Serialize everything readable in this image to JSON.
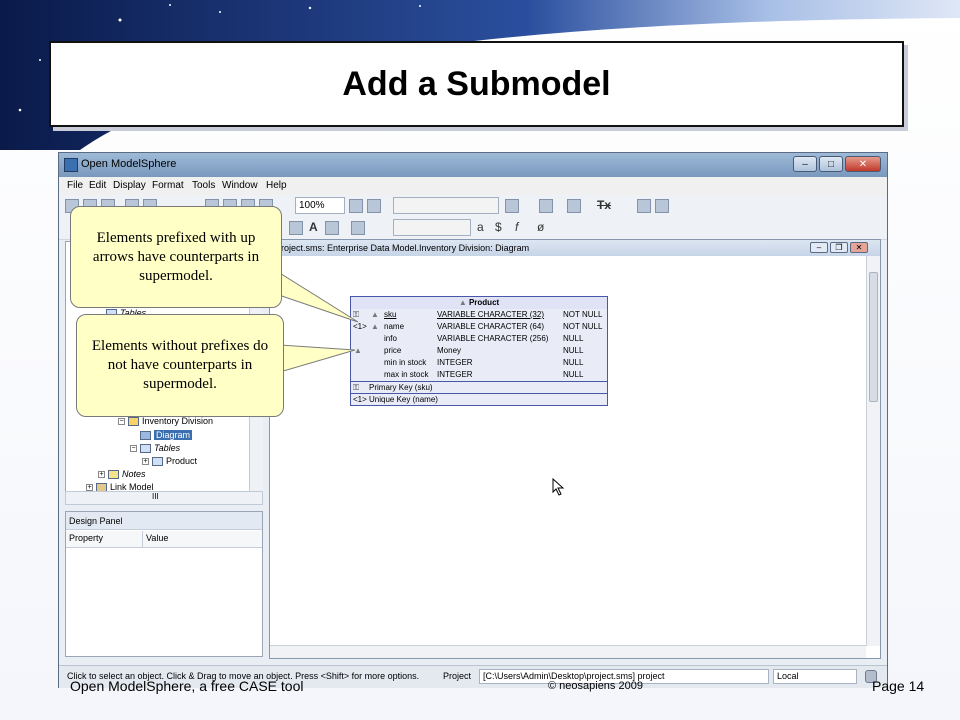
{
  "slide": {
    "title": "Add a Submodel",
    "footer_left": "Open ModelSphere, a free CASE tool",
    "footer_center": "© neosapiens 2009",
    "footer_right": "Page 14"
  },
  "window": {
    "title": "Open ModelSphere",
    "buttons": {
      "minimize": "–",
      "maximize": "□",
      "close": "✕"
    }
  },
  "menubar": {
    "items": [
      "File",
      "Edit",
      "Display",
      "Format",
      "Tools",
      "Window",
      "Help"
    ]
  },
  "toolbar": {
    "zoom_value": "100%",
    "font_glyph_a": "A",
    "text_glyph_a": "a",
    "text_glyph_dollar": "$",
    "text_glyph_f": "f",
    "text_glyph_null": "ø",
    "tx_glyph": "Tx"
  },
  "explorer": {
    "tree": [
      {
        "label": "Tables",
        "icon": "table-icon"
      },
      {
        "label": "Inventory Division",
        "icon": "model-icon"
      },
      {
        "label": "Diagram",
        "icon": "diagram-icon"
      },
      {
        "label": "Tables",
        "icon": "table-icon"
      },
      {
        "label": "Product",
        "icon": "table-icon"
      },
      {
        "label": "Notes",
        "icon": "folder-icon"
      },
      {
        "label": "Link Model",
        "icon": "link-model-icon"
      }
    ],
    "scroll_grip": "III"
  },
  "design_panel": {
    "title": "Design Panel",
    "columns": [
      "Property",
      "Value"
    ]
  },
  "diagram": {
    "title": "project.sms: Enterprise Data Model.Inventory Division: Diagram"
  },
  "product_table": {
    "name": "Product",
    "columns": [
      {
        "prefix": "",
        "name": "sku",
        "type": "VARIABLE CHARACTER (32)",
        "null": "NOT NULL",
        "underline": true
      },
      {
        "prefix": "<1>",
        "name": "name",
        "type": "VARIABLE CHARACTER (64)",
        "null": "NOT NULL",
        "underline": false
      },
      {
        "prefix": "",
        "name": "info",
        "type": "VARIABLE CHARACTER (256)",
        "null": "NULL",
        "underline": false
      },
      {
        "prefix": "",
        "name": "price",
        "type": "Money",
        "null": "NULL",
        "underline": false
      },
      {
        "prefix": "",
        "name": "min in stock",
        "type": "INTEGER",
        "null": "NULL",
        "underline": false
      },
      {
        "prefix": "",
        "name": "max in stock",
        "type": "INTEGER",
        "null": "NULL",
        "underline": false
      }
    ],
    "primary_key": "Primary Key (sku)",
    "unique_key": "<1> Unique Key (name)"
  },
  "callouts": {
    "callout1": "Elements prefixed with up arrows have counterparts in supermodel.",
    "callout2": "Elements without prefixes do not have counterparts in supermodel."
  },
  "statusbar": {
    "hint": "Click to select an object.  Click & Drag to move an object.  Press <Shift> for more options.",
    "project_label": "Project",
    "project_path": "[C:\\Users\\Admin\\Desktop\\project.sms]  project",
    "location": "Local"
  },
  "colors": {
    "callout_fill": "#ffffc6",
    "title_bar": "#7898bd",
    "table_border": "#4a57a6"
  }
}
